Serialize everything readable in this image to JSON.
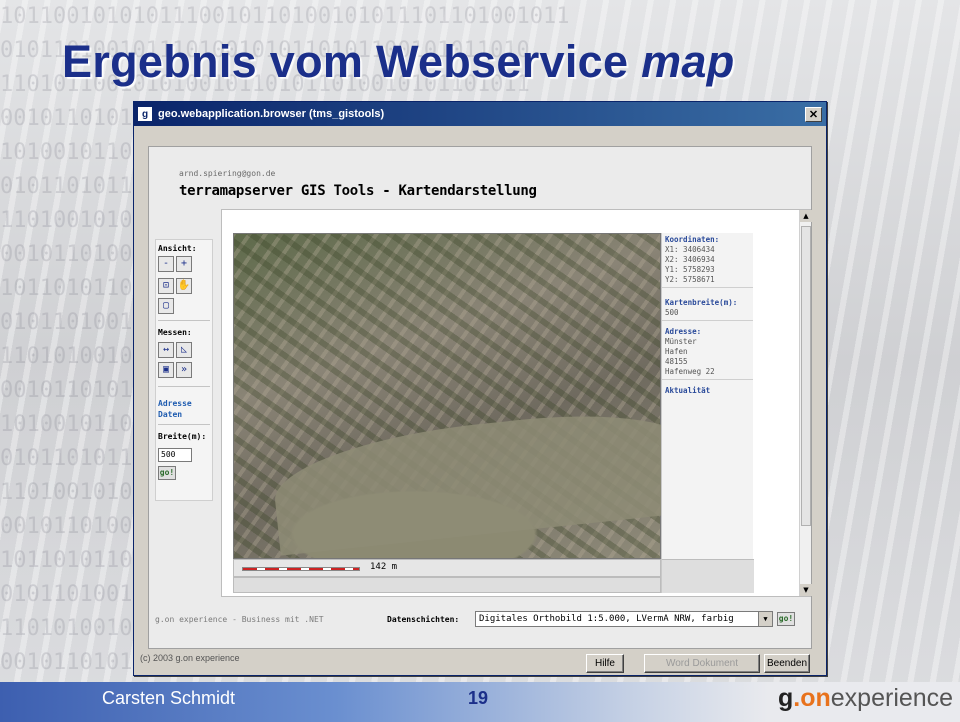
{
  "slide": {
    "title_main": "Ergebnis vom Webservice ",
    "title_em": "map",
    "presenter": "Carsten Schmidt",
    "page_number": "19",
    "logo": {
      "g": "g",
      "dot": ".on",
      "experience": "experience"
    }
  },
  "window": {
    "icon_letter": "g",
    "title": "geo.webapplication.browser (tms_gistools)",
    "close_glyph": "✕"
  },
  "app": {
    "user": "arnd.spiering@gon.de",
    "heading": "terramapserver GIS Tools - Kartendarstellung"
  },
  "left_panel": {
    "view_label": "Ansicht:",
    "measure_label": "Messen:",
    "address_link_1": "Adresse",
    "address_link_2": "Daten",
    "width_label": "Breite(m):",
    "width_value": "500",
    "go_label": "go!",
    "tools": {
      "zoom_out": "-",
      "zoom_in": "+",
      "zoom_box": "⊡",
      "pan": "✋",
      "full_extent": "▢",
      "measure_distance": "↔",
      "measure_area": "◺",
      "point": "▣",
      "forward": "»"
    }
  },
  "map": {
    "scale_text": "142 m"
  },
  "info": {
    "coords_label": "Koordinaten:",
    "x1": "X1: 3406434",
    "x2": "X2: 3406934",
    "y1": "Y1: 5758293",
    "y2": "Y2: 5758671",
    "width_label": "Kartenbreite(m):",
    "width_value": "500",
    "address_label": "Adresse:",
    "address_1": "Münster",
    "address_2": "Hafen",
    "address_3": "48155",
    "address_4": "Hafenweg 22",
    "actuality_label": "Aktualität"
  },
  "footer": {
    "brand": "g.on experience - Business mit .NET",
    "layers_label": "Datenschichten:",
    "layers_value": "Digitales Orthobild 1:5.000, LVermA NRW, farbig",
    "go_label": "go!"
  },
  "statusbar": {
    "copyright": "(c) 2003 g.on experience",
    "help": "Hilfe",
    "word": "Word Dokument",
    "exit": "Beenden"
  }
}
